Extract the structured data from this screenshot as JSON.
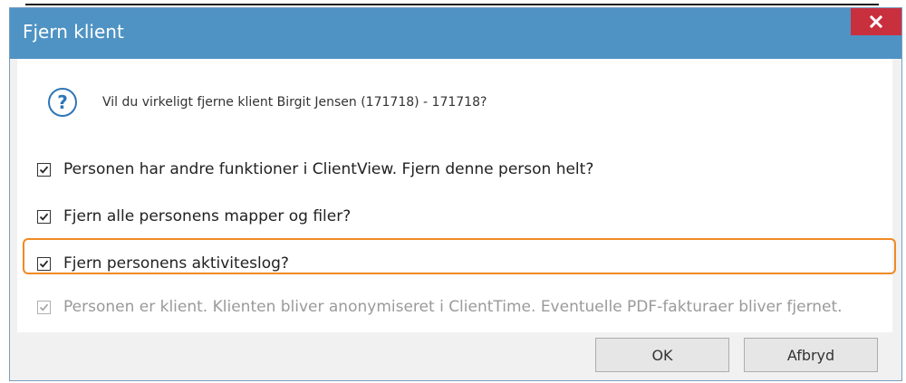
{
  "dialog": {
    "title": "Fjern klient",
    "close_glyph": "✕",
    "question_icon": "question-circle-icon",
    "question": "Vil du virkeligt fjerne klient Birgit Jensen (171718) - 171718?"
  },
  "options": [
    {
      "label": "Personen har andre funktioner i ClientView. Fjern denne person helt?",
      "checked": true,
      "disabled": false
    },
    {
      "label": "Fjern alle personens mapper og filer?",
      "checked": true,
      "disabled": false
    },
    {
      "label": "Fjern personens aktiviteslog?",
      "checked": true,
      "disabled": false
    },
    {
      "label": "Personen er klient. Klienten bliver anonymiseret i ClientTime. Eventuelle PDF-fakturaer bliver fjernet.",
      "checked": true,
      "disabled": true
    }
  ],
  "buttons": {
    "ok": "OK",
    "cancel": "Afbryd"
  },
  "colors": {
    "titlebar": "#4f93c4",
    "close": "#c9303e",
    "highlight": "#f08a24"
  }
}
